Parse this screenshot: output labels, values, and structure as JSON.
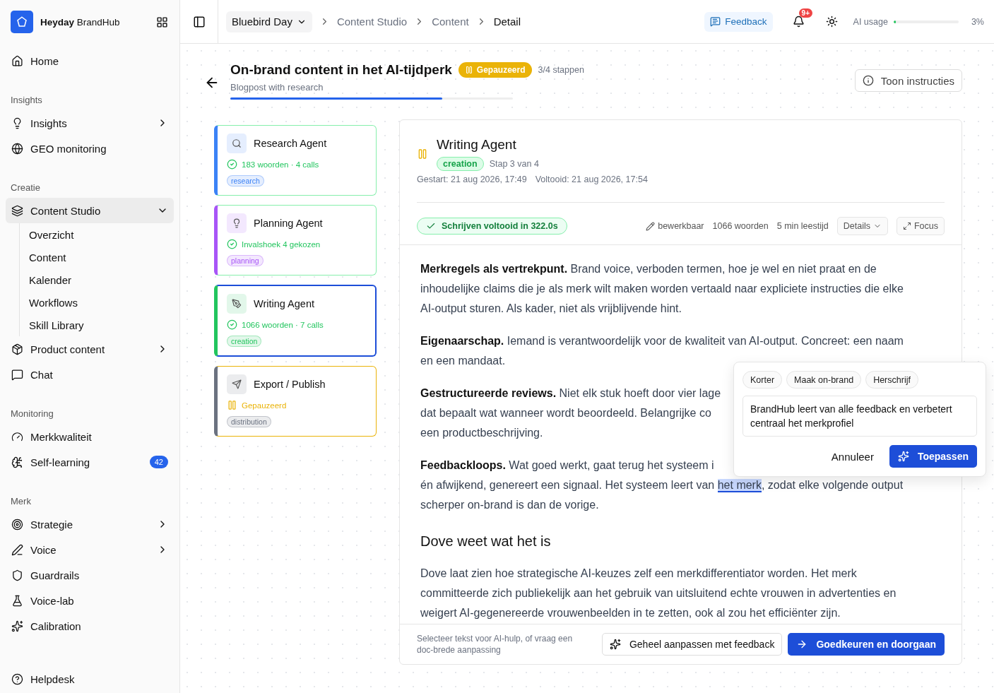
{
  "sidebar": {
    "brand": "**Heyday** BrandHub",
    "sections": [
      {
        "items": [
          {
            "label": "Home",
            "selected": false,
            "has_submenu": false
          }
        ]
      },
      {
        "heading": "Insights",
        "items": [
          {
            "label": "Insights",
            "selected": false,
            "has_submenu": true
          },
          {
            "label": "GEO monitoring",
            "selected": false,
            "has_submenu": false
          }
        ]
      },
      {
        "heading": "Creatie",
        "items": [
          {
            "label": "Content Studio",
            "selected": true,
            "has_submenu": true,
            "expanded": true,
            "children": [
              {
                "label": "Overzicht",
                "selected": false
              },
              {
                "label": "Content",
                "selected": false
              },
              {
                "label": "Kalender",
                "selected": false
              },
              {
                "label": "Workflows",
                "selected": false
              },
              {
                "label": "Skill Library",
                "selected": false
              }
            ]
          },
          {
            "label": "Product content",
            "selected": false,
            "has_submenu": true
          },
          {
            "label": "Chat",
            "selected": false,
            "has_submenu": false
          }
        ]
      },
      {
        "heading": "Monitoring",
        "items": [
          {
            "label": "Merkkwaliteit",
            "selected": false,
            "has_submenu": false
          },
          {
            "label": "Self-learning",
            "selected": false,
            "has_submenu": false,
            "badge": "42"
          }
        ]
      },
      {
        "heading": "Merk",
        "items": [
          {
            "label": "Strategie",
            "selected": false,
            "has_submenu": true
          },
          {
            "label": "Voice",
            "selected": false,
            "has_submenu": true
          },
          {
            "label": "Guardrails",
            "selected": false,
            "has_submenu": false
          },
          {
            "label": "Voice-lab",
            "selected": false,
            "has_submenu": false
          },
          {
            "label": "Calibration",
            "selected": false,
            "has_submenu": false
          }
        ]
      }
    ],
    "footer_item": "Helpdesk"
  },
  "topbar": {
    "workspace": "Bluebird Day",
    "breadcrumb": [
      "Content Studio",
      "Content",
      "Detail"
    ],
    "feedback": "Feedback",
    "notifications": "9+",
    "ai_usage": {
      "label": "AI usage",
      "level": 0.03,
      "reading": "3%"
    }
  },
  "header": {
    "title": "On-brand content in het AI-tijdperk",
    "status": {
      "kind": "paused",
      "label": "Gepauzeerd"
    },
    "steps": "3/4 stappen",
    "subtitle": "Blogpost with research",
    "progress": {
      "level": 0.75
    },
    "instructions_button": "Toon instructies"
  },
  "agents": [
    {
      "name": "Research Agent",
      "completed": true,
      "summary": "183 woorden · 4 calls",
      "tag": "research",
      "color": "#3b82f6",
      "selected": false
    },
    {
      "name": "Planning Agent",
      "completed": true,
      "summary": "Invalshoek 4 gekozen",
      "tag": "planning",
      "color": "#a855f7",
      "selected": false
    },
    {
      "name": "Writing Agent",
      "completed": true,
      "summary": "1066 woorden · 7 calls",
      "tag": "creation",
      "color": "#22c55e",
      "selected": true
    },
    {
      "name": "Export / Publish",
      "completed": false,
      "summary": "Gepauzeerd",
      "tag": "distribution",
      "color": "#6b7280",
      "selected": false
    }
  ],
  "detail": {
    "title": "Writing Agent",
    "paused": true,
    "tag": "creation",
    "step": "Stap 3 van 4",
    "started": "Gestart: 21 aug 2026, 17:49",
    "finished": "Voltooid: 21 aug 2026, 17:54",
    "result": "Schrijven voltooid in 322.0s",
    "editable": "bewerkbaar",
    "words": "1066 woorden",
    "reading_time": "5 min leestijd",
    "details_button": "Details",
    "focus_button": "Focus",
    "body": [
      {
        "kind": "paragraph",
        "lines": [
          [
            {
              "text": "**Merkregels als vertrekpunt.** Brand voice, verboden termen, hoe je wel en niet praat en de",
              "selected": false
            }
          ],
          [
            {
              "text": "inhoudelijke claims die je als merk wilt maken worden vertaald naar expliciete instructies die elke",
              "selected": false
            }
          ],
          [
            {
              "text": "AI-output sturen. Als kader, niet als vrijblijvende hint.",
              "selected": false
            }
          ]
        ]
      },
      {
        "kind": "paragraph",
        "lines": [
          [
            {
              "text": "**Eigenaarschap.** Iemand is verantwoordelijk voor de kwaliteit van AI-output. Concreet: een naam",
              "selected": false
            }
          ],
          [
            {
              "text": "en een mandaat.",
              "selected": false
            }
          ]
        ]
      },
      {
        "kind": "paragraph",
        "lines": [
          [
            {
              "text": "**Gestructureerde reviews.** Niet elk stuk hoeft door vier lage",
              "selected": false
            }
          ],
          [
            {
              "text": "dat bepaalt wat wanneer wordt beoordeeld. Belangrijke co",
              "selected": false
            }
          ],
          [
            {
              "text": "een productbeschrijving.",
              "selected": false
            }
          ]
        ]
      },
      {
        "kind": "paragraph",
        "lines": [
          [
            {
              "text": "**Feedbackloops.** Wat goed werkt, gaat terug het systeem i",
              "selected": false
            }
          ],
          [
            {
              "text": "én afwijkend, genereert een signaal. Het systeem leert van ",
              "selected": false
            },
            {
              "text": "het merk",
              "selected": true
            },
            {
              "text": ", zodat elke volgende output",
              "selected": false
            }
          ],
          [
            {
              "text": "scherper on-brand is dan de vorige.",
              "selected": false
            }
          ]
        ]
      },
      {
        "kind": "heading",
        "text": "Dove weet wat het is"
      },
      {
        "kind": "paragraph",
        "lines": [
          [
            {
              "text": "Dove laat zien hoe strategische AI-keuzes zelf een merkdifferentiator worden. Het merk",
              "selected": false
            }
          ],
          [
            {
              "text": "committeerde zich publiekelijk aan het gebruik van uitsluitend echte vrouwen in advertenties en",
              "selected": false
            }
          ],
          [
            {
              "text": "weigert AI-gegenereerde vrouwenbeelden in te zetten, ook al zou het efficiënter zijn.",
              "selected": false
            }
          ]
        ]
      }
    ],
    "footer_hint": "Selecteer tekst voor AI-hulp, of vraag een doc-brede aanpassing",
    "revise_button": "Geheel aanpassen met feedback",
    "approve_button": "Goedkeuren en doorgaan"
  },
  "popover": {
    "chips": [
      "Korter",
      "Maak on-brand",
      "Herschrijf"
    ],
    "value": "BrandHub leert van alle feedback en verbetert centraal het merkprofiel",
    "cancel": "Annuleer",
    "apply": "Toepassen"
  }
}
